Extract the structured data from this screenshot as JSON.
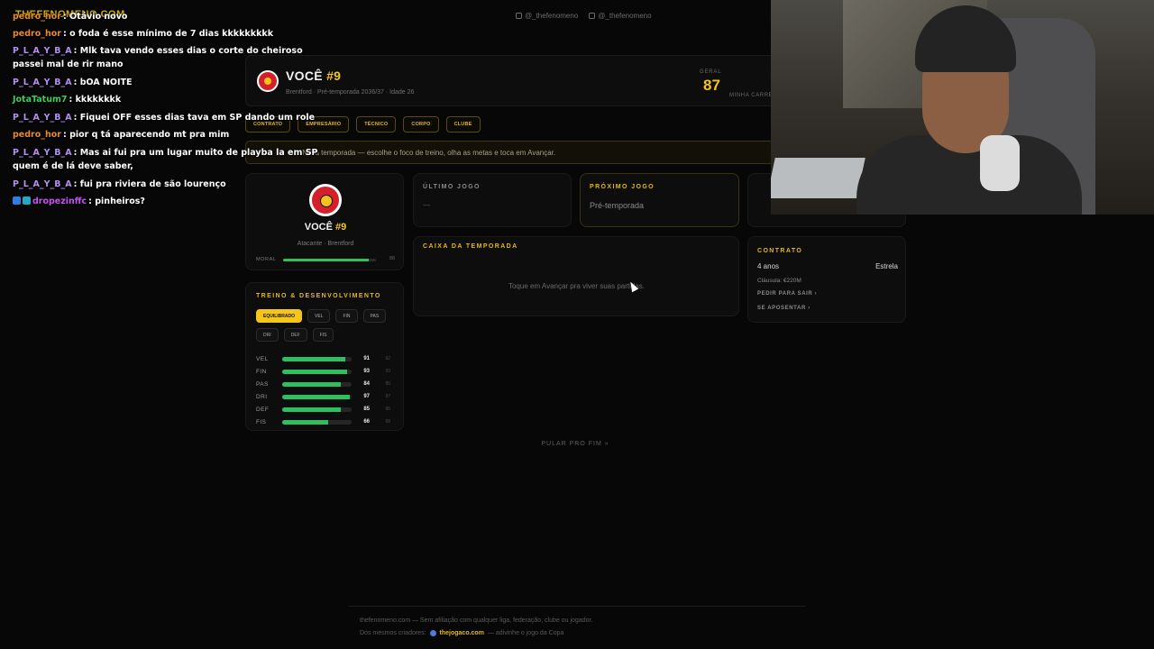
{
  "social": {
    "instagram": "@_thefenomeno",
    "tiktok": "@_thefenomeno"
  },
  "player": {
    "name": "VOCÊ",
    "number": "#9",
    "subtitle": "Brentford · Pré-temporada 2036/37 · Idade 26",
    "overall_label": "GERAL",
    "overall": "87",
    "career_label": "MINHA CARREIRA",
    "position_club": "Atacante · Brentford",
    "morale_label": "MORAL",
    "morale_value": "88",
    "morale_pct": 0.92
  },
  "tabs": [
    "CONTRATO",
    "EMPRESÁRIO",
    "TÉCNICO",
    "CORPO",
    "CLUBE"
  ],
  "notice": "— Nova temporada — escolhe o foco de treino, olha as metas e toca em Avançar.",
  "training": {
    "title": "TREINO & DESENVOLVIMENTO",
    "focus": [
      "EQUILIBRADO",
      "VEL",
      "FIN",
      "PAS",
      "DRI",
      "DEF",
      "FIS"
    ],
    "stats": [
      {
        "key": "VEL",
        "value": "91",
        "potential": "92",
        "pct": 0.91
      },
      {
        "key": "FIN",
        "value": "93",
        "potential": "93",
        "pct": 0.93
      },
      {
        "key": "PAS",
        "value": "84",
        "potential": "85",
        "pct": 0.84
      },
      {
        "key": "DRI",
        "value": "97",
        "potential": "97",
        "pct": 0.97
      },
      {
        "key": "DEF",
        "value": "85",
        "potential": "86",
        "pct": 0.85
      },
      {
        "key": "FIS",
        "value": "66",
        "potential": "68",
        "pct": 0.66
      }
    ]
  },
  "last_match": {
    "label": "ÚLTIMO JOGO",
    "value": "—"
  },
  "next_match": {
    "label": "PRÓXIMO JOGO",
    "value": "Pré-temporada"
  },
  "inbox": {
    "label": "CAIXA DA TEMPORADA",
    "message": "Toque em Avançar pra viver suas partidas."
  },
  "contract": {
    "label": "CONTRATO",
    "years": "4 anos",
    "status": "Estrela",
    "clause": "Cláusula: €220M",
    "leave": "PEDIR PARA SAIR ›",
    "retire": "SE APOSENTAR ›"
  },
  "skip": "PULAR PRO FIM »",
  "footer": {
    "line1": "thefenomeno.com — Sem afiliação com qualquer liga, federação, clube ou jogador.",
    "line2_prefix": "Dos mesmos criadores:",
    "brand": "thejogaco.com",
    "line2_suffix": "— adivinhe o jogo da Copa"
  },
  "overlay_tag": "THEFENOMENO.COM",
  "chat": [
    {
      "user": "pedro_hor",
      "text": ": Otávio novo",
      "color": "u1"
    },
    {
      "user": "pedro_hor",
      "text": ": o foda é esse mínimo de 7 dias kkkkkkkkk",
      "color": "u1"
    },
    {
      "user": "P_L_A_Y_B_A",
      "text": ": Mlk tava vendo esses dias o corte do cheiroso passei mal de rir mano",
      "color": "u2"
    },
    {
      "user": "P_L_A_Y_B_A",
      "text": ": bOA NOITE",
      "color": "u2"
    },
    {
      "user": "JotaTatum7",
      "text": ": kkkkkkkk",
      "color": "u3"
    },
    {
      "user": "P_L_A_Y_B_A",
      "text": ": Fiquei OFF esses dias tava em SP dando um role",
      "color": "u2"
    },
    {
      "user": "pedro_hor",
      "text": ": pior q tá aparecendo mt pra mim",
      "color": "u1"
    },
    {
      "user": "P_L_A_Y_B_A",
      "text": ": Mas ai fui pra um lugar muito de playba la em SP quem é de lá deve saber,",
      "color": "u2"
    },
    {
      "user": "P_L_A_Y_B_A",
      "text": ": fui pra riviera de são lourenço",
      "color": "u2"
    },
    {
      "user": "dropezinffc",
      "text": ": pinheiros?",
      "color": "u4"
    }
  ]
}
